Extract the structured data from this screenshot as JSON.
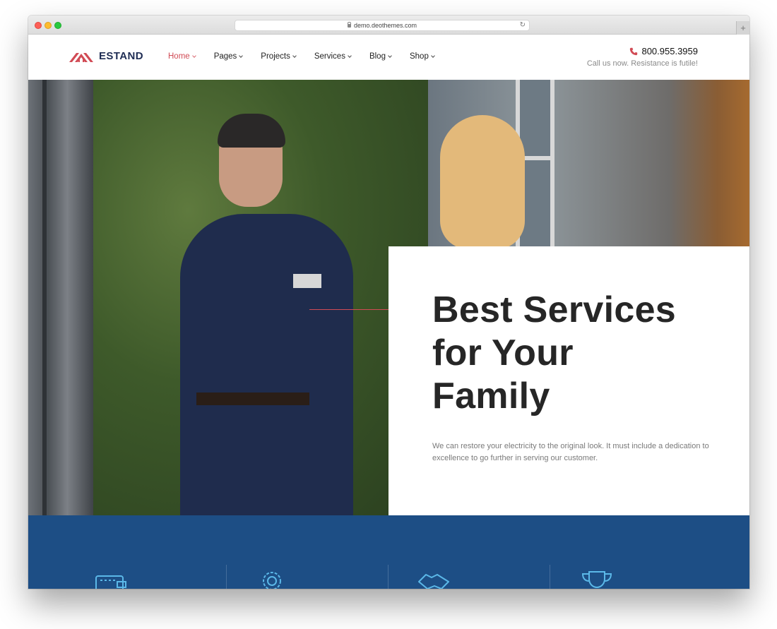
{
  "browser": {
    "url": "demo.deothemes.com"
  },
  "header": {
    "logo_text": "ESTAND",
    "nav": [
      {
        "label": "Home",
        "active": true
      },
      {
        "label": "Pages",
        "active": false
      },
      {
        "label": "Projects",
        "active": false
      },
      {
        "label": "Services",
        "active": false
      },
      {
        "label": "Blog",
        "active": false
      },
      {
        "label": "Shop",
        "active": false
      }
    ],
    "phone": "800.955.3959",
    "phone_sub": "Call us now. Resistance is futile!"
  },
  "hero": {
    "title": "Best Services for Your Family",
    "description": "We can restore your electricity to the original look. It must include a dedication to excellence to go further in serving our customer."
  },
  "features": {
    "icons": [
      "wallet-icon",
      "gear-icon",
      "handshake-icon",
      "trophy-icon"
    ]
  },
  "colors": {
    "accent": "#d14b55",
    "brand_dark": "#1f2d54",
    "features_bg": "#1d4e85",
    "icon_blue": "#5bb8e8"
  }
}
